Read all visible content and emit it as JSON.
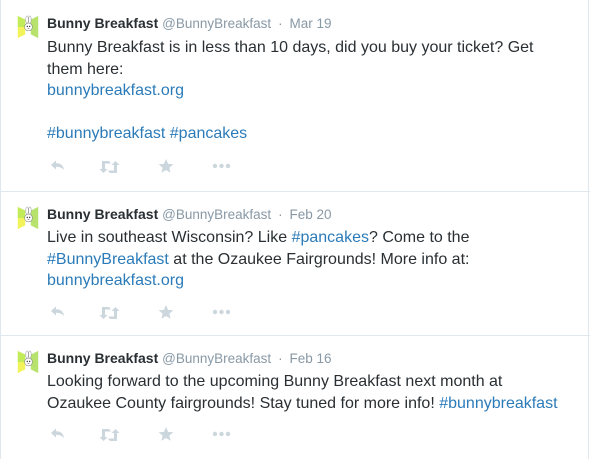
{
  "tweets": [
    {
      "name": "Bunny Breakfast",
      "handle": "@BunnyBreakfast",
      "separator": "·",
      "time": "Mar 19",
      "line1": "Bunny Breakfast is in less than 10 days, did you buy your ticket? Get",
      "line2": "them here:",
      "link": "bunnybreakfast.org",
      "hashtag1": "#bunnybreakfast",
      "hashtag2": "#pancakes"
    },
    {
      "name": "Bunny Breakfast",
      "handle": "@BunnyBreakfast",
      "separator": "·",
      "time": "Feb 20",
      "l1a": "Live in southeast Wisconsin? Like ",
      "l1tag": "#pancakes",
      "l1b": "? Come to the",
      "l2tag": "#BunnyBreakfast",
      "l2b": " at the Ozaukee Fairgrounds! More info at:",
      "link": "bunnybreakfast.org"
    },
    {
      "name": "Bunny Breakfast",
      "handle": "@BunnyBreakfast",
      "separator": "·",
      "time": "Feb 16",
      "line1": "Looking forward to the upcoming Bunny Breakfast next month at",
      "l2a": "Ozaukee County fairgrounds! Stay tuned for more info! ",
      "l2tag": "#bunnybreakfast"
    }
  ],
  "actions": [
    "reply-icon",
    "retweet-icon",
    "favorite-icon",
    "more-icon"
  ],
  "colors": {
    "link": "#2b7bb9",
    "meta": "#8899a6",
    "icon": "#ccd6dd",
    "divider": "#e1e8ed",
    "avatar_yellow": "#f2f25a",
    "avatar_green": "#b7e26b"
  }
}
